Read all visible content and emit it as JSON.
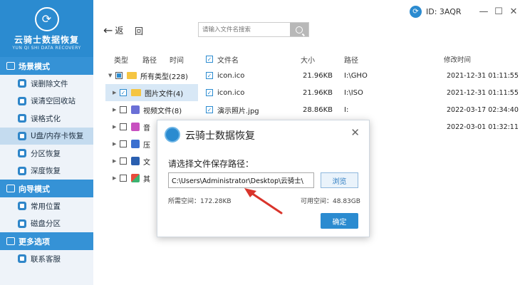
{
  "app": {
    "name": "云骑士数据恢复",
    "subtitle": "YUN QI SHI DATA RECOVERY",
    "id_label": "ID: 3AQR"
  },
  "sidebar": {
    "sections": [
      {
        "title": "场景模式",
        "items": [
          {
            "label": "误删除文件"
          },
          {
            "label": "误清空回收站"
          },
          {
            "label": "误格式化"
          },
          {
            "label": "U盘/内存卡恢复"
          },
          {
            "label": "分区恢复"
          },
          {
            "label": "深度恢复"
          }
        ]
      },
      {
        "title": "向导模式",
        "items": [
          {
            "label": "常用位置"
          },
          {
            "label": "磁盘分区"
          }
        ]
      },
      {
        "title": "更多选项",
        "items": [
          {
            "label": "联系客服"
          }
        ]
      }
    ]
  },
  "toolbar": {
    "back_label": "返",
    "home_label": "回",
    "search_placeholder": "请输入文件名搜索"
  },
  "tree": {
    "headers": [
      "类型",
      "路径",
      "时间"
    ],
    "rows": [
      {
        "label": "所有类型(228)"
      },
      {
        "label": "图片文件(4)"
      },
      {
        "label": "视频文件(8)"
      },
      {
        "label": "音"
      },
      {
        "label": "压"
      },
      {
        "label": "文"
      },
      {
        "label": "其"
      }
    ]
  },
  "files": {
    "headers": {
      "name": "文件名",
      "size": "大小",
      "path": "路径",
      "date": "修改时间"
    },
    "rows": [
      {
        "name": "icon.ico",
        "size": "21.96KB",
        "path": "I:\\GHO",
        "date": "2021-12-31 01:11:55"
      },
      {
        "name": "icon.ico",
        "size": "21.96KB",
        "path": "I:\\ISO",
        "date": "2021-12-31 01:11:55"
      },
      {
        "name": "演示照片.jpg",
        "size": "28.86KB",
        "path": "I:",
        "date": "2022-03-17 02:34:40"
      },
      {
        "name": "",
        "size": "",
        "path": "",
        "date": "2022-03-01 01:32:11"
      }
    ]
  },
  "dialog": {
    "title": "云骑士数据恢复",
    "prompt": "请选择文件保存路径：",
    "path_value": "C:\\Users\\Administrator\\Desktop\\云骑士\\",
    "browse_label": "浏览",
    "needed_space": "所需空间：172.28KB",
    "free_space": "可用空间：48.83GB",
    "ok_label": "确定"
  },
  "colors": {
    "brand": "#2b8bd0",
    "arrow": "#d9342b"
  }
}
